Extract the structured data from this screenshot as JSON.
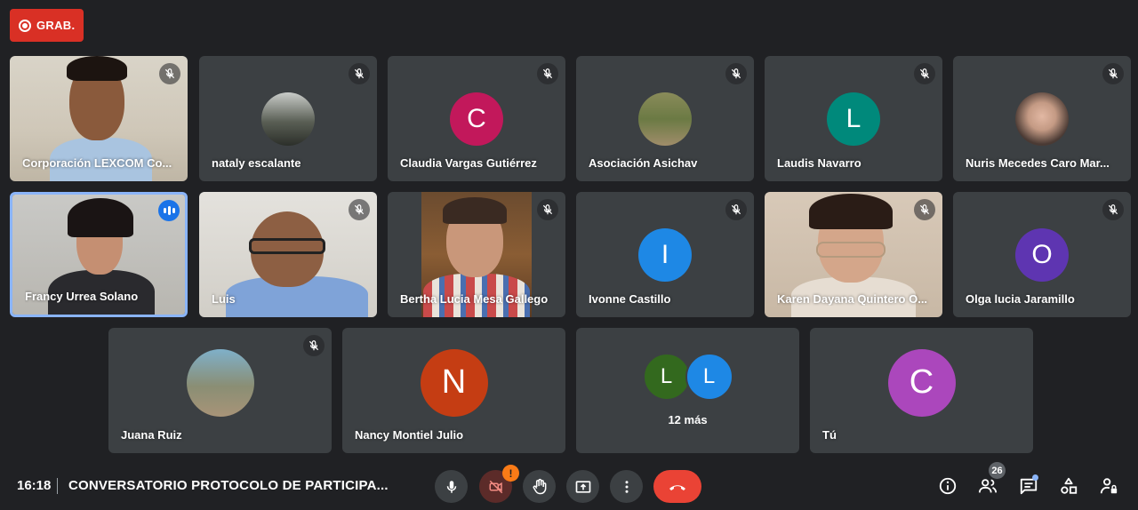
{
  "recording": {
    "label": "GRAB."
  },
  "tiles": {
    "t1": {
      "name": "Corporación LEXCOM Co..."
    },
    "t2": {
      "name": "nataly escalante"
    },
    "t3": {
      "name": "Claudia Vargas Gutiérrez",
      "initial": "C",
      "color": "#c2185b"
    },
    "t4": {
      "name": "Asociación Asichav"
    },
    "t5": {
      "name": "Laudis Navarro",
      "initial": "L",
      "color": "#00897b"
    },
    "t6": {
      "name": "Nuris Mecedes Caro Mar..."
    },
    "t7": {
      "name": "Francy Urrea Solano"
    },
    "t8": {
      "name": "Luis"
    },
    "t9": {
      "name": "Bertha Lucia Mesa Gallego"
    },
    "t10": {
      "name": "Ivonne Castillo",
      "initial": "I",
      "color": "#1e88e5"
    },
    "t11": {
      "name": "Karen Dayana Quintero O..."
    },
    "t12": {
      "name": "Olga lucia Jaramillo",
      "initial": "O",
      "color": "#5e35b1"
    },
    "t13": {
      "name": "Juana Ruiz"
    },
    "t14": {
      "name": "Nancy Montiel Julio",
      "initial": "N",
      "color": "#c53d13"
    },
    "t15": {
      "more": "12 más",
      "a1": "L",
      "a1_color": "#33691e",
      "a2": "L",
      "a2_color": "#1e88e5"
    },
    "t16": {
      "name": "Tú",
      "initial": "C",
      "color": "#ab47bc"
    }
  },
  "bottom": {
    "time": "16:18",
    "meeting_title": "CONVERSATORIO PROTOCOLO DE PARTICIPA...",
    "participants_count": "26",
    "camera_warning": "!"
  }
}
